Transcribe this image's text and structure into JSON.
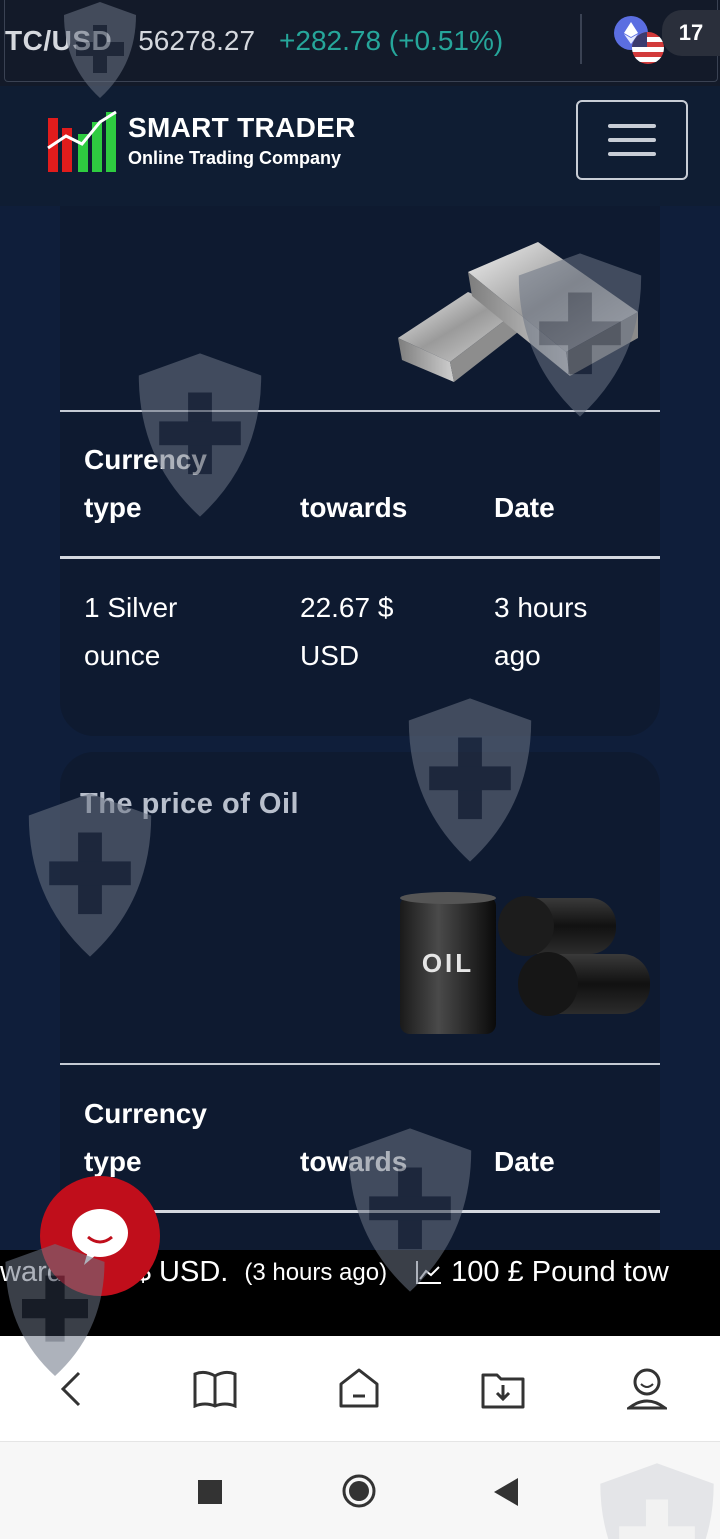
{
  "ticker_top": {
    "symbol": "TC/USD",
    "price": "56278.27",
    "change": "+282.78 (+0.51%)",
    "logo_text": "17"
  },
  "header": {
    "brand_title": "SMART TRADER",
    "brand_subtitle": "Online Trading Company"
  },
  "silver_card": {
    "image": "silver-bars",
    "columns": [
      "Currency type",
      "towards",
      "Date"
    ],
    "row": {
      "type": "1 Silver ounce",
      "towards": "22.67 $ USD",
      "date": "3 hours ago"
    }
  },
  "oil_card": {
    "title": "The price of Oil",
    "image": "oil-barrels",
    "barrel_label": "OIL",
    "columns": [
      "Currency type",
      "towards",
      "Date"
    ]
  },
  "bottom_ticker": {
    "fragment_left": "ward",
    "fragment_value": "$ USD.",
    "fragment_time": "(3 hours ago)",
    "next_item": "100 £ Pound tow"
  },
  "colors": {
    "background": "#0f1e3a",
    "card": "#0e1a30",
    "positive": "#26a69a",
    "chat_button": "#c00e1b"
  },
  "icons": [
    "ethereum-icon",
    "us-flag-icon",
    "tradingview-icon",
    "hamburger-icon",
    "chart-icon",
    "chat-icon",
    "back-icon",
    "book-icon",
    "home-icon",
    "download-icon",
    "profile-icon",
    "square-icon",
    "circle-icon",
    "triangle-back-icon",
    "shield-watermark-icon"
  ]
}
